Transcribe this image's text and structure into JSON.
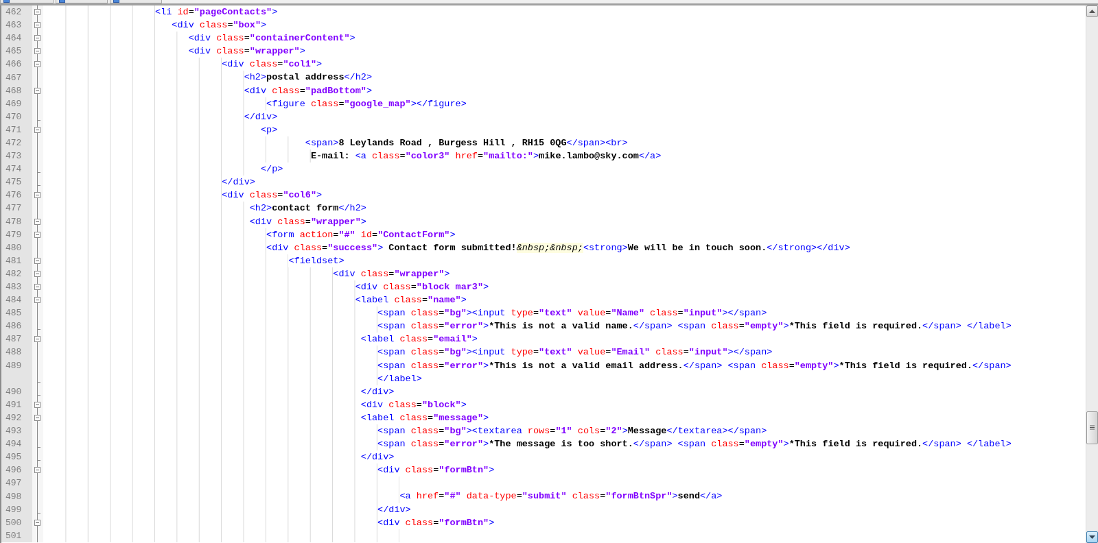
{
  "editor": {
    "rows": [
      {
        "n": "462",
        "kind": "fold-start",
        "indent": "\t\t\t\t\t",
        "tokens": [
          {
            "kind": "tag",
            "text": "<li "
          },
          {
            "kind": "attr",
            "text": "id"
          },
          {
            "kind": "op",
            "text": "="
          },
          {
            "kind": "value",
            "text": "\"pageContacts\""
          },
          {
            "kind": "tag",
            "text": ">"
          }
        ]
      },
      {
        "n": "463",
        "kind": "fold-start",
        "indent": "\t\t\t\t\t   ",
        "tokens": [
          {
            "kind": "tag",
            "text": "<div "
          },
          {
            "kind": "attr",
            "text": "class"
          },
          {
            "kind": "op",
            "text": "="
          },
          {
            "kind": "value",
            "text": "\"box\""
          },
          {
            "kind": "tag",
            "text": ">"
          }
        ]
      },
      {
        "n": "464",
        "kind": "fold-start",
        "indent": "\t\t\t\t\t\t  ",
        "tokens": [
          {
            "kind": "tag",
            "text": "<div "
          },
          {
            "kind": "attr",
            "text": "class"
          },
          {
            "kind": "op",
            "text": "="
          },
          {
            "kind": "value",
            "text": "\"containerContent\""
          },
          {
            "kind": "tag",
            "text": ">"
          }
        ]
      },
      {
        "n": "465",
        "kind": "fold-start",
        "indent": "\t\t\t\t\t\t  ",
        "tokens": [
          {
            "kind": "tag",
            "text": "<div "
          },
          {
            "kind": "attr",
            "text": "class"
          },
          {
            "kind": "op",
            "text": "="
          },
          {
            "kind": "value",
            "text": "\"wrapper\""
          },
          {
            "kind": "tag",
            "text": ">"
          }
        ]
      },
      {
        "n": "466",
        "kind": "fold-start",
        "indent": "\t\t\t\t\t\t\t\t",
        "tokens": [
          {
            "kind": "tag",
            "text": "<div "
          },
          {
            "kind": "attr",
            "text": "class"
          },
          {
            "kind": "op",
            "text": "="
          },
          {
            "kind": "value",
            "text": "\"col1\""
          },
          {
            "kind": "tag",
            "text": ">"
          }
        ]
      },
      {
        "n": "467",
        "kind": "plain",
        "indent": "\t\t\t\t\t\t\t\t\t",
        "tokens": [
          {
            "kind": "tag",
            "text": "<h2>"
          },
          {
            "kind": "text",
            "text": "postal address"
          },
          {
            "kind": "tag",
            "text": "</h2>"
          }
        ]
      },
      {
        "n": "468",
        "kind": "fold-start",
        "indent": "\t\t\t\t\t\t\t\t\t",
        "tokens": [
          {
            "kind": "tag",
            "text": "<div "
          },
          {
            "kind": "attr",
            "text": "class"
          },
          {
            "kind": "op",
            "text": "="
          },
          {
            "kind": "value",
            "text": "\"padBottom\""
          },
          {
            "kind": "tag",
            "text": ">"
          }
        ]
      },
      {
        "n": "469",
        "kind": "plain",
        "indent": "\t\t\t\t\t\t\t\t\t\t",
        "tokens": [
          {
            "kind": "tag",
            "text": "<figure "
          },
          {
            "kind": "attr",
            "text": "class"
          },
          {
            "kind": "op",
            "text": "="
          },
          {
            "kind": "value",
            "text": "\"google_map\""
          },
          {
            "kind": "tag",
            "text": "></figure>"
          }
        ]
      },
      {
        "n": "470",
        "kind": "fold-end",
        "indent": "\t\t\t\t\t\t\t\t\t",
        "tokens": [
          {
            "kind": "tag",
            "text": "</div>"
          }
        ]
      },
      {
        "n": "471",
        "kind": "fold-start",
        "indent": "\t\t\t\t\t\t\t\t\t   ",
        "tokens": [
          {
            "kind": "tag",
            "text": "<p>"
          }
        ]
      },
      {
        "n": "472",
        "kind": "plain",
        "indent": "\t\t\t\t\t\t\t\t\t\t\t   ",
        "tokens": [
          {
            "kind": "tag",
            "text": "<span>"
          },
          {
            "kind": "text",
            "text": "8 Leylands Road , Burgess Hill , RH15 0QG"
          },
          {
            "kind": "tag",
            "text": "</span><br>"
          }
        ]
      },
      {
        "n": "473",
        "kind": "plain",
        "indent": "\t\t\t\t\t\t\t\t\t\t\t\t",
        "tokens": [
          {
            "kind": "text",
            "text": "E-mail: "
          },
          {
            "kind": "tag",
            "text": "<a "
          },
          {
            "kind": "attr",
            "text": "class"
          },
          {
            "kind": "op",
            "text": "="
          },
          {
            "kind": "value",
            "text": "\"color3\""
          },
          {
            "kind": "attr",
            "text": " href"
          },
          {
            "kind": "op",
            "text": "="
          },
          {
            "kind": "value",
            "text": "\"mailto:\""
          },
          {
            "kind": "tag",
            "text": ">"
          },
          {
            "kind": "text",
            "text": "mike.lambo@sky.com"
          },
          {
            "kind": "tag",
            "text": "</a>"
          }
        ]
      },
      {
        "n": "474",
        "kind": "fold-end",
        "indent": "\t\t\t\t\t\t\t\t\t   ",
        "tokens": [
          {
            "kind": "tag",
            "text": "</p>"
          }
        ]
      },
      {
        "n": "475",
        "kind": "fold-end",
        "indent": "\t\t\t\t\t\t\t\t",
        "tokens": [
          {
            "kind": "tag",
            "text": "</div>"
          }
        ]
      },
      {
        "n": "476",
        "kind": "fold-start",
        "indent": "\t\t\t\t\t\t\t\t",
        "tokens": [
          {
            "kind": "tag",
            "text": "<div "
          },
          {
            "kind": "attr",
            "text": "class"
          },
          {
            "kind": "op",
            "text": "="
          },
          {
            "kind": "value",
            "text": "\"col6\""
          },
          {
            "kind": "tag",
            "text": ">"
          }
        ]
      },
      {
        "n": "477",
        "kind": "plain",
        "indent": "\t\t\t\t\t\t\t\t\t ",
        "tokens": [
          {
            "kind": "tag",
            "text": "<h2>"
          },
          {
            "kind": "text",
            "text": "contact form"
          },
          {
            "kind": "tag",
            "text": "</h2>"
          }
        ]
      },
      {
        "n": "478",
        "kind": "fold-start",
        "indent": "\t\t\t\t\t\t\t\t\t ",
        "tokens": [
          {
            "kind": "tag",
            "text": "<div "
          },
          {
            "kind": "attr",
            "text": "class"
          },
          {
            "kind": "op",
            "text": "="
          },
          {
            "kind": "value",
            "text": "\"wrapper\""
          },
          {
            "kind": "tag",
            "text": ">"
          }
        ]
      },
      {
        "n": "479",
        "kind": "fold-start",
        "indent": "\t\t\t\t\t\t\t\t\t\t",
        "tokens": [
          {
            "kind": "tag",
            "text": "<form "
          },
          {
            "kind": "attr",
            "text": "action"
          },
          {
            "kind": "op",
            "text": "="
          },
          {
            "kind": "value",
            "text": "\"#\""
          },
          {
            "kind": "attr",
            "text": " id"
          },
          {
            "kind": "op",
            "text": "="
          },
          {
            "kind": "value",
            "text": "\"ContactForm\""
          },
          {
            "kind": "tag",
            "text": ">"
          }
        ]
      },
      {
        "n": "480",
        "kind": "plain",
        "indent": "\t\t\t\t\t\t\t\t\t\t",
        "tokens": [
          {
            "kind": "tag",
            "text": "<div "
          },
          {
            "kind": "attr",
            "text": "class"
          },
          {
            "kind": "op",
            "text": "="
          },
          {
            "kind": "value",
            "text": "\"success\""
          },
          {
            "kind": "tag",
            "text": ">"
          },
          {
            "kind": "text",
            "text": " Contact form submitted!"
          },
          {
            "kind": "entity",
            "text": "&nbsp;&nbsp;"
          },
          {
            "kind": "tag",
            "text": "<strong>"
          },
          {
            "kind": "text",
            "text": "We will be in touch soon."
          },
          {
            "kind": "tag",
            "text": "</strong></div>"
          }
        ]
      },
      {
        "n": "481",
        "kind": "fold-start",
        "indent": "\t\t\t\t\t\t\t\t\t\t\t",
        "tokens": [
          {
            "kind": "tag",
            "text": "<fieldset>"
          }
        ]
      },
      {
        "n": "482",
        "kind": "fold-start",
        "indent": "\t\t\t\t\t\t\t\t\t\t\t\t\t",
        "tokens": [
          {
            "kind": "tag",
            "text": "<div "
          },
          {
            "kind": "attr",
            "text": "class"
          },
          {
            "kind": "op",
            "text": "="
          },
          {
            "kind": "value",
            "text": "\"wrapper\""
          },
          {
            "kind": "tag",
            "text": ">"
          }
        ]
      },
      {
        "n": "483",
        "kind": "fold-start",
        "indent": "\t\t\t\t\t\t\t\t\t\t\t\t\t\t",
        "tokens": [
          {
            "kind": "tag",
            "text": "<div "
          },
          {
            "kind": "attr",
            "text": "class"
          },
          {
            "kind": "op",
            "text": "="
          },
          {
            "kind": "value",
            "text": "\"block mar3\""
          },
          {
            "kind": "tag",
            "text": ">"
          }
        ]
      },
      {
        "n": "484",
        "kind": "fold-start",
        "indent": "\t\t\t\t\t\t\t\t\t\t\t\t\t\t",
        "tokens": [
          {
            "kind": "tag",
            "text": "<label "
          },
          {
            "kind": "attr",
            "text": "class"
          },
          {
            "kind": "op",
            "text": "="
          },
          {
            "kind": "value",
            "text": "\"name\""
          },
          {
            "kind": "tag",
            "text": ">"
          }
        ]
      },
      {
        "n": "485",
        "kind": "plain",
        "indent": "\t\t\t\t\t\t\t\t\t\t\t\t\t\t\t",
        "tokens": [
          {
            "kind": "tag",
            "text": "<span "
          },
          {
            "kind": "attr",
            "text": "class"
          },
          {
            "kind": "op",
            "text": "="
          },
          {
            "kind": "value",
            "text": "\"bg\""
          },
          {
            "kind": "tag",
            "text": "><input "
          },
          {
            "kind": "attr",
            "text": "type"
          },
          {
            "kind": "op",
            "text": "="
          },
          {
            "kind": "value",
            "text": "\"text\""
          },
          {
            "kind": "attr",
            "text": " value"
          },
          {
            "kind": "op",
            "text": "="
          },
          {
            "kind": "value",
            "text": "\"Name\""
          },
          {
            "kind": "attr",
            "text": " class"
          },
          {
            "kind": "op",
            "text": "="
          },
          {
            "kind": "value",
            "text": "\"input\""
          },
          {
            "kind": "tag",
            "text": "></span>"
          }
        ]
      },
      {
        "n": "486",
        "kind": "fold-end",
        "indent": "\t\t\t\t\t\t\t\t\t\t\t\t\t\t\t",
        "tokens": [
          {
            "kind": "tag",
            "text": "<span "
          },
          {
            "kind": "attr",
            "text": "class"
          },
          {
            "kind": "op",
            "text": "="
          },
          {
            "kind": "value",
            "text": "\"error\""
          },
          {
            "kind": "tag",
            "text": ">"
          },
          {
            "kind": "text",
            "text": "*This is not a valid name."
          },
          {
            "kind": "tag",
            "text": "</span> <span "
          },
          {
            "kind": "attr",
            "text": "class"
          },
          {
            "kind": "op",
            "text": "="
          },
          {
            "kind": "value",
            "text": "\"empty\""
          },
          {
            "kind": "tag",
            "text": ">"
          },
          {
            "kind": "text",
            "text": "*This field is required."
          },
          {
            "kind": "tag",
            "text": "</span> </label>"
          }
        ]
      },
      {
        "n": "487",
        "kind": "fold-start",
        "indent": "\t\t\t\t\t\t\t\t\t\t\t\t\t\t ",
        "tokens": [
          {
            "kind": "tag",
            "text": "<label "
          },
          {
            "kind": "attr",
            "text": "class"
          },
          {
            "kind": "op",
            "text": "="
          },
          {
            "kind": "value",
            "text": "\"email\""
          },
          {
            "kind": "tag",
            "text": ">"
          }
        ]
      },
      {
        "n": "488",
        "kind": "plain",
        "indent": "\t\t\t\t\t\t\t\t\t\t\t\t\t\t\t",
        "tokens": [
          {
            "kind": "tag",
            "text": "<span "
          },
          {
            "kind": "attr",
            "text": "class"
          },
          {
            "kind": "op",
            "text": "="
          },
          {
            "kind": "value",
            "text": "\"bg\""
          },
          {
            "kind": "tag",
            "text": "><input "
          },
          {
            "kind": "attr",
            "text": "type"
          },
          {
            "kind": "op",
            "text": "="
          },
          {
            "kind": "value",
            "text": "\"text\""
          },
          {
            "kind": "attr",
            "text": " value"
          },
          {
            "kind": "op",
            "text": "="
          },
          {
            "kind": "value",
            "text": "\"Email\""
          },
          {
            "kind": "attr",
            "text": " class"
          },
          {
            "kind": "op",
            "text": "="
          },
          {
            "kind": "value",
            "text": "\"input\""
          },
          {
            "kind": "tag",
            "text": "></span>"
          }
        ]
      },
      {
        "n": "489",
        "kind": "plain",
        "indent": "\t\t\t\t\t\t\t\t\t\t\t\t\t\t\t",
        "tokens": [
          {
            "kind": "tag",
            "text": "<span "
          },
          {
            "kind": "attr",
            "text": "class"
          },
          {
            "kind": "op",
            "text": "="
          },
          {
            "kind": "value",
            "text": "\"error\""
          },
          {
            "kind": "tag",
            "text": ">"
          },
          {
            "kind": "text",
            "text": "*This is not a valid email address."
          },
          {
            "kind": "tag",
            "text": "</span> <span "
          },
          {
            "kind": "attr",
            "text": "class"
          },
          {
            "kind": "op",
            "text": "="
          },
          {
            "kind": "value",
            "text": "\"empty\""
          },
          {
            "kind": "tag",
            "text": ">"
          },
          {
            "kind": "text",
            "text": "*This field is required."
          },
          {
            "kind": "tag",
            "text": "</span>"
          }
        ]
      },
      {
        "kind": "fold-end",
        "indent": "\t\t\t\t\t\t\t\t\t\t\t\t\t\t\t",
        "tokens": [
          {
            "kind": "tag",
            "text": "</label>"
          }
        ]
      },
      {
        "n": "490",
        "kind": "fold-end",
        "indent": "\t\t\t\t\t\t\t\t\t\t\t\t\t\t ",
        "tokens": [
          {
            "kind": "tag",
            "text": "</div>"
          }
        ]
      },
      {
        "n": "491",
        "kind": "fold-start",
        "indent": "\t\t\t\t\t\t\t\t\t\t\t\t\t\t ",
        "tokens": [
          {
            "kind": "tag",
            "text": "<div "
          },
          {
            "kind": "attr",
            "text": "class"
          },
          {
            "kind": "op",
            "text": "="
          },
          {
            "kind": "value",
            "text": "\"block\""
          },
          {
            "kind": "tag",
            "text": ">"
          }
        ]
      },
      {
        "n": "492",
        "kind": "fold-start",
        "indent": "\t\t\t\t\t\t\t\t\t\t\t\t\t\t ",
        "tokens": [
          {
            "kind": "tag",
            "text": "<label "
          },
          {
            "kind": "attr",
            "text": "class"
          },
          {
            "kind": "op",
            "text": "="
          },
          {
            "kind": "value",
            "text": "\"message\""
          },
          {
            "kind": "tag",
            "text": ">"
          }
        ]
      },
      {
        "n": "493",
        "kind": "plain",
        "indent": "\t\t\t\t\t\t\t\t\t\t\t\t\t\t\t",
        "tokens": [
          {
            "kind": "tag",
            "text": "<span "
          },
          {
            "kind": "attr",
            "text": "class"
          },
          {
            "kind": "op",
            "text": "="
          },
          {
            "kind": "value",
            "text": "\"bg\""
          },
          {
            "kind": "tag",
            "text": "><textarea "
          },
          {
            "kind": "attr",
            "text": "rows"
          },
          {
            "kind": "op",
            "text": "="
          },
          {
            "kind": "value",
            "text": "\"1\""
          },
          {
            "kind": "attr",
            "text": " cols"
          },
          {
            "kind": "op",
            "text": "="
          },
          {
            "kind": "value",
            "text": "\"2\""
          },
          {
            "kind": "tag",
            "text": ">"
          },
          {
            "kind": "text",
            "text": "Message"
          },
          {
            "kind": "tag",
            "text": "</textarea></span>"
          }
        ]
      },
      {
        "n": "494",
        "kind": "fold-end",
        "indent": "\t\t\t\t\t\t\t\t\t\t\t\t\t\t\t",
        "tokens": [
          {
            "kind": "tag",
            "text": "<span "
          },
          {
            "kind": "attr",
            "text": "class"
          },
          {
            "kind": "op",
            "text": "="
          },
          {
            "kind": "value",
            "text": "\"error\""
          },
          {
            "kind": "tag",
            "text": ">"
          },
          {
            "kind": "text",
            "text": "*The message is too short."
          },
          {
            "kind": "tag",
            "text": "</span> <span "
          },
          {
            "kind": "attr",
            "text": "class"
          },
          {
            "kind": "op",
            "text": "="
          },
          {
            "kind": "value",
            "text": "\"empty\""
          },
          {
            "kind": "tag",
            "text": ">"
          },
          {
            "kind": "text",
            "text": "*This field is required."
          },
          {
            "kind": "tag",
            "text": "</span> </label>"
          }
        ]
      },
      {
        "n": "495",
        "kind": "fold-end",
        "indent": "\t\t\t\t\t\t\t\t\t\t\t\t\t\t ",
        "tokens": [
          {
            "kind": "tag",
            "text": "</div>"
          }
        ]
      },
      {
        "n": "496",
        "kind": "fold-start",
        "indent": "\t\t\t\t\t\t\t\t\t\t\t\t\t\t\t",
        "tokens": [
          {
            "kind": "tag",
            "text": "<div "
          },
          {
            "kind": "attr",
            "text": "class"
          },
          {
            "kind": "op",
            "text": "="
          },
          {
            "kind": "value",
            "text": "\"formBtn\""
          },
          {
            "kind": "tag",
            "text": ">"
          }
        ]
      },
      {
        "n": "497",
        "kind": "plain",
        "indent": "\t\t\t\t\t\t\t\t\t\t\t\t\t\t\t\t",
        "tokens": []
      },
      {
        "n": "498",
        "kind": "plain",
        "indent": "\t\t\t\t\t\t\t\t\t\t\t\t\t\t\t\t",
        "tokens": [
          {
            "kind": "tag",
            "text": "<a "
          },
          {
            "kind": "attr",
            "text": "href"
          },
          {
            "kind": "op",
            "text": "="
          },
          {
            "kind": "value",
            "text": "\"#\""
          },
          {
            "kind": "attr",
            "text": " data-type"
          },
          {
            "kind": "op",
            "text": "="
          },
          {
            "kind": "value",
            "text": "\"submit\""
          },
          {
            "kind": "attr",
            "text": " class"
          },
          {
            "kind": "op",
            "text": "="
          },
          {
            "kind": "value",
            "text": "\"formBtnSpr\""
          },
          {
            "kind": "tag",
            "text": ">"
          },
          {
            "kind": "text",
            "text": "send"
          },
          {
            "kind": "tag",
            "text": "</a>"
          }
        ]
      },
      {
        "n": "499",
        "kind": "fold-end",
        "indent": "\t\t\t\t\t\t\t\t\t\t\t\t\t\t\t",
        "tokens": [
          {
            "kind": "tag",
            "text": "</div>"
          }
        ]
      },
      {
        "n": "500",
        "kind": "fold-start",
        "indent": "\t\t\t\t\t\t\t\t\t\t\t\t\t\t\t",
        "tokens": [
          {
            "kind": "tag",
            "text": "<div "
          },
          {
            "kind": "attr",
            "text": "class"
          },
          {
            "kind": "op",
            "text": "="
          },
          {
            "kind": "value",
            "text": "\"formBtn\""
          },
          {
            "kind": "tag",
            "text": ">"
          }
        ]
      },
      {
        "n": "501",
        "kind": "plain",
        "indent": "\t\t\t\t\t\t\t\t\t\t\t\t\t\t\t\t",
        "tokens": []
      }
    ]
  }
}
